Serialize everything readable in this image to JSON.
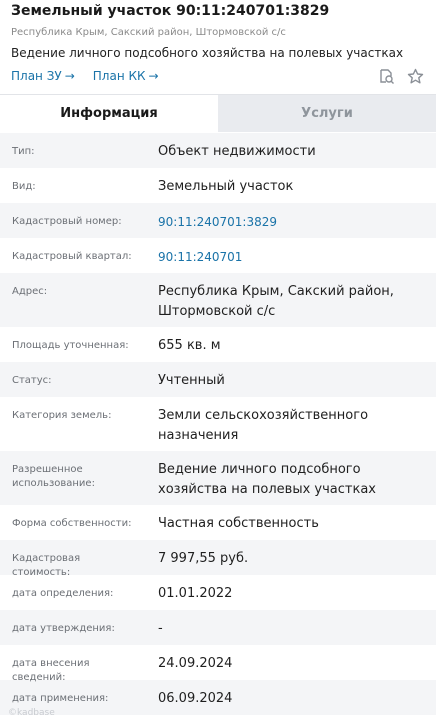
{
  "header": {
    "title": "Земельный участок 90:11:240701:3829",
    "subtitle": "Республика Крым, Сакский район, Штормовской с/с",
    "usage": "Ведение личного подсобного хозяйства на полевых участках",
    "links": [
      {
        "label": "План ЗУ",
        "arrow": "→"
      },
      {
        "label": "План КК",
        "arrow": "→"
      }
    ],
    "icons": [
      "search-document-icon",
      "star-icon"
    ]
  },
  "tabs": [
    {
      "label": "Информация",
      "active": true
    },
    {
      "label": "Услуги",
      "active": false
    }
  ],
  "rows": [
    {
      "label": "Тип:",
      "value": "Объект недвижимости"
    },
    {
      "label": "Вид:",
      "value": "Земельный участок"
    },
    {
      "label": "Кадастровый номер:",
      "value": "90:11:240701:3829",
      "link": true
    },
    {
      "label": "Кадастровый квартал:",
      "value": "90:11:240701",
      "link": true
    },
    {
      "label": "Адрес:",
      "value": "Республика Крым, Сакский район, Штормовской с/с"
    },
    {
      "label": "Площадь уточненная:",
      "value": "655 кв. м"
    },
    {
      "label": "Статус:",
      "value": "Учтенный"
    },
    {
      "label": "Категория земель:",
      "value": "Земли сельскохозяйственного назначения"
    },
    {
      "label": "Разрешенное использование:",
      "value": "Ведение личного подсобного хозяйства на полевых участках"
    },
    {
      "label": "Форма собственности:",
      "value": "Частная собственность"
    },
    {
      "label": "Кадастровая стоимость:",
      "value": "7 997,55 руб."
    },
    {
      "label": "дата определения:",
      "value": "01.01.2022"
    },
    {
      "label": "дата утверждения:",
      "value": "-"
    },
    {
      "label": "дата внесения сведений:",
      "value": "24.09.2024"
    },
    {
      "label": "дата применения:",
      "value": "06.09.2024"
    }
  ],
  "watermark": "©kadbase"
}
